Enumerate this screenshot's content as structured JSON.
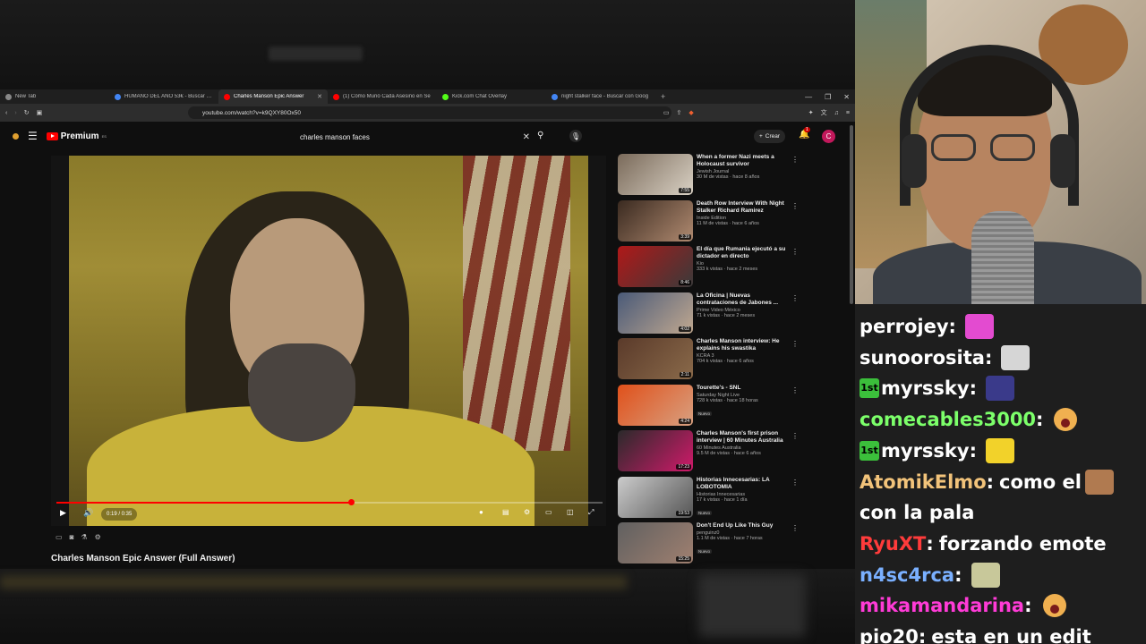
{
  "browser": {
    "tabs": [
      {
        "title": "New Tab",
        "active": false,
        "icon_color": "#888888"
      },
      {
        "title": "HUMANO DEL AÑO 53€ - Buscar con",
        "active": false,
        "icon_color": "#4285f4"
      },
      {
        "title": "Charles Manson Epic Answer",
        "active": true,
        "icon_color": "#ff0000"
      },
      {
        "title": "(1) Cómo Murió Cada Asesino en Se",
        "active": false,
        "icon_color": "#ff0000"
      },
      {
        "title": "Kick.com Chat Overlay",
        "active": false,
        "icon_color": "#53fc18"
      },
      {
        "title": "night stalker face - Buscar con Goog",
        "active": false,
        "icon_color": "#4285f4"
      }
    ],
    "url": "youtube.com/watch?v=k9QXY80Ox50"
  },
  "youtube": {
    "logo_text": "Premium",
    "logo_sup": "ES",
    "search_value": "charles manson faces",
    "create_label": "Crear",
    "notif_count": "1",
    "avatar_letter": "C",
    "video": {
      "title": "Charles Manson Epic Answer (Full Answer)",
      "time": "0:19 / 0:35",
      "progress": 0.54
    }
  },
  "related": [
    {
      "title": "When a former Nazi meets a Holocaust survivor",
      "channel": "Jewish Journal",
      "views": "30 M de vistas · hace 8 años",
      "duration": "7:55",
      "badge": "",
      "thumb": [
        "#7a6a5a",
        "#d9d1c4"
      ]
    },
    {
      "title": "Death Row Interview With Night Stalker Richard Ramirez",
      "channel": "Inside Edition",
      "views": "11 M de vistas · hace 6 años",
      "duration": "3:39",
      "badge": "",
      "thumb": [
        "#3a2a20",
        "#b08a70"
      ]
    },
    {
      "title": "El día que Rumania ejecutó a su dictador en directo",
      "channel": "Kio",
      "views": "333 k vistas · hace 2 meses",
      "duration": "8:46",
      "badge": "",
      "thumb": [
        "#b01818",
        "#3a3a3a"
      ]
    },
    {
      "title": "La Oficina | Nuevas contrataciones de Jabones ...",
      "channel": "Prime Video México",
      "views": "71 k vistas · hace 2 meses",
      "duration": "4:02",
      "badge": "",
      "thumb": [
        "#4a5a78",
        "#c0a890"
      ]
    },
    {
      "title": "Charles Manson interview: He explains his swastika",
      "channel": "KCRA 3",
      "views": "704 k vistas · hace 6 años",
      "duration": "2:11",
      "badge": "",
      "thumb": [
        "#5a3a2a",
        "#8a6a4a"
      ]
    },
    {
      "title": "Tourette's - SNL",
      "channel": "Saturday Night Live",
      "views": "728 k vistas · hace 18 horas",
      "duration": "4:24",
      "badge": "Nuevo",
      "thumb": [
        "#e0501a",
        "#d8a080"
      ]
    },
    {
      "title": "Charles Manson's first prison interview | 60 Minutes Australia",
      "channel": "60 Minutes Australia",
      "views": "9.5 M de vistas · hace 6 años",
      "duration": "17:23",
      "badge": "",
      "thumb": [
        "#2a2a2a",
        "#d01a6a"
      ]
    },
    {
      "title": "Historias Innecesarias: LA LOBOTOMIA",
      "channel": "Historias Innecesarias",
      "views": "17 k vistas · hace 1 día",
      "duration": "19:53",
      "badge": "Nuevo",
      "thumb": [
        "#cccccc",
        "#555555"
      ]
    },
    {
      "title": "Don't End Up Like This Guy",
      "channel": "penguinz0",
      "views": "1.1 M de vistas · hace 7 horas",
      "duration": "15:25",
      "badge": "Nuevo",
      "thumb": [
        "#606060",
        "#a08070"
      ]
    }
  ],
  "chat": [
    {
      "user": "perrojey",
      "color": "#ffffff",
      "badge": "",
      "text": "",
      "emote": "#e34bd0"
    },
    {
      "user": "sunoorosita",
      "color": "#ffffff",
      "badge": "",
      "text": "",
      "emote": "#d6d6d6"
    },
    {
      "user": "myrssky",
      "color": "#ffffff",
      "badge": "1st",
      "text": "",
      "emote": "#3a3a8a"
    },
    {
      "user": "comecables3000",
      "color": "#7cff6a",
      "badge": "",
      "text": "",
      "emote": "face"
    },
    {
      "user": "myrssky",
      "color": "#ffffff",
      "badge": "1st",
      "text": "",
      "emote": "#f2d22a"
    },
    {
      "user": "AtomikElmo",
      "color": "#f2c37a",
      "badge": "",
      "text": "como el",
      "emote": "#b07a50"
    },
    {
      "user": "",
      "color": "#ffffff",
      "badge": "",
      "text": "con la pala",
      "emote": ""
    },
    {
      "user": "RyuXT",
      "color": "#ff3b3b",
      "badge": "",
      "text": "forzando emote",
      "emote": ""
    },
    {
      "user": "n4sc4rca",
      "color": "#7ab0ff",
      "badge": "",
      "text": "",
      "emote": "#c8c89a"
    },
    {
      "user": "mikamandarina",
      "color": "#ff3bd7",
      "badge": "",
      "text": "",
      "emote": "face"
    },
    {
      "user": "pio20",
      "color": "#ffffff",
      "badge": "",
      "text": "esta en un edit",
      "emote": ""
    }
  ]
}
